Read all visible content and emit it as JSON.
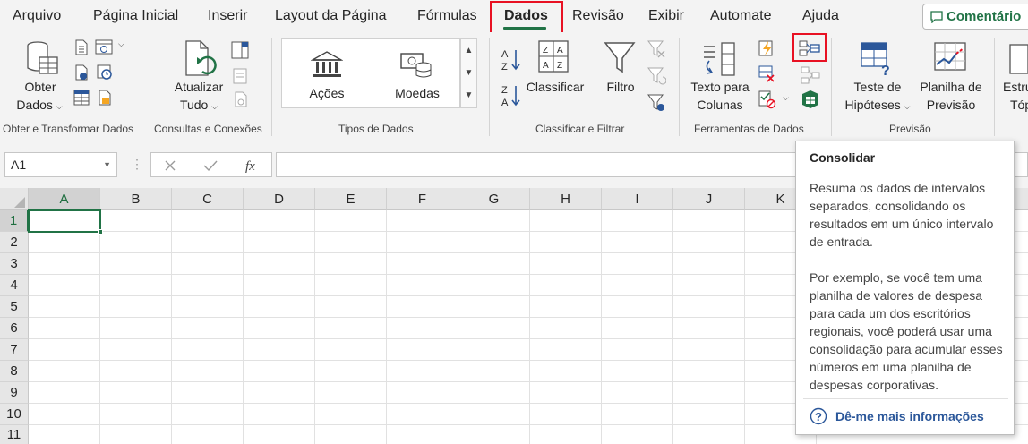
{
  "menu": {
    "tabs": [
      {
        "label": "Arquivo"
      },
      {
        "label": "Página Inicial"
      },
      {
        "label": "Inserir"
      },
      {
        "label": "Layout da Página"
      },
      {
        "label": "Fórmulas"
      },
      {
        "label": "Dados",
        "active": true
      },
      {
        "label": "Revisão"
      },
      {
        "label": "Exibir"
      },
      {
        "label": "Automate"
      },
      {
        "label": "Ajuda"
      }
    ],
    "comments_button": "Comentário"
  },
  "ribbon": {
    "groups": {
      "obter": "Obter e Transformar Dados",
      "consultas": "Consultas e Conexões",
      "tipos": "Tipos de Dados",
      "classificar": "Classificar e Filtrar",
      "ferramentas": "Ferramentas de Dados",
      "previsao": "Previsão"
    },
    "buttons": {
      "obter_l1": "Obter",
      "obter_l2": "Dados",
      "atualizar_l1": "Atualizar",
      "atualizar_l2": "Tudo",
      "acoes": "Ações",
      "moedas": "Moedas",
      "classificar": "Classificar",
      "filtro": "Filtro",
      "texto_l1": "Texto para",
      "texto_l2": "Colunas",
      "teste_l1": "Teste de",
      "teste_l2": "Hipóteses",
      "planilha_l1": "Planilha de",
      "planilha_l2": "Previsão",
      "estrutura_l1": "Estru",
      "estrutura_l2": "Tóp"
    }
  },
  "formula_bar": {
    "name_box": "A1",
    "formula": ""
  },
  "sheet": {
    "columns": [
      "A",
      "B",
      "C",
      "D",
      "E",
      "F",
      "G",
      "H",
      "I",
      "J",
      "K"
    ],
    "rows": [
      "1",
      "2",
      "3",
      "4",
      "5",
      "6",
      "7",
      "8",
      "9",
      "10",
      "11"
    ],
    "active_cell": "A1"
  },
  "tooltip": {
    "title": "Consolidar",
    "para1": "Resuma os dados de intervalos separados, consolidando os resultados em um único intervalo de entrada.",
    "para2": "Por exemplo, se você tem uma planilha de valores de despesa para cada um dos escritórios regionais, você poderá usar uma consolidação para acumular esses números em uma planilha de despesas corporativas.",
    "link": "Dê-me mais informações"
  },
  "colors": {
    "accent": "#217346",
    "highlight": "#e81123",
    "link": "#2b579a"
  }
}
